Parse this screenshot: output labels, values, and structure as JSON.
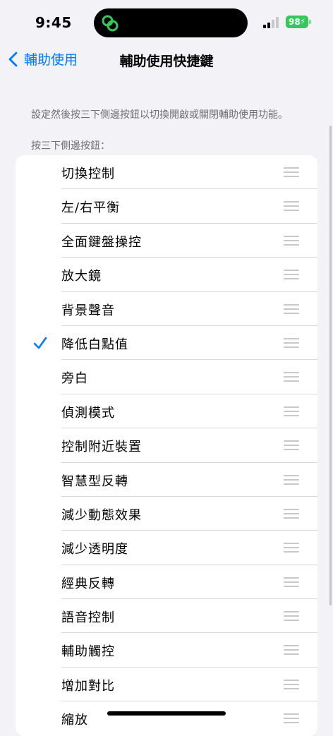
{
  "status_bar": {
    "time": "9:45",
    "battery": "98",
    "island_icon": "link-icon",
    "colors": {
      "battery": "#34c759",
      "island_icon": "#34c759"
    }
  },
  "nav": {
    "back_label": "輔助使用",
    "title": "輔助使用快捷鍵",
    "accent": "#007aff"
  },
  "description": "設定然後按三下側邊按鈕以切換開啟或關閉輔助使用功能。",
  "section_header": "按三下側邊按鈕：",
  "items": [
    {
      "label": "切換控制",
      "checked": false
    },
    {
      "label": "左/右平衡",
      "checked": false
    },
    {
      "label": "全面鍵盤操控",
      "checked": false
    },
    {
      "label": "放大鏡",
      "checked": false
    },
    {
      "label": "背景聲音",
      "checked": false
    },
    {
      "label": "降低白點值",
      "checked": true
    },
    {
      "label": "旁白",
      "checked": false
    },
    {
      "label": "偵測模式",
      "checked": false
    },
    {
      "label": "控制附近裝置",
      "checked": false
    },
    {
      "label": "智慧型反轉",
      "checked": false
    },
    {
      "label": "減少動態效果",
      "checked": false
    },
    {
      "label": "減少透明度",
      "checked": false
    },
    {
      "label": "經典反轉",
      "checked": false
    },
    {
      "label": "語音控制",
      "checked": false
    },
    {
      "label": "輔助觸控",
      "checked": false
    },
    {
      "label": "增加對比",
      "checked": false
    },
    {
      "label": "縮放",
      "checked": false
    }
  ]
}
